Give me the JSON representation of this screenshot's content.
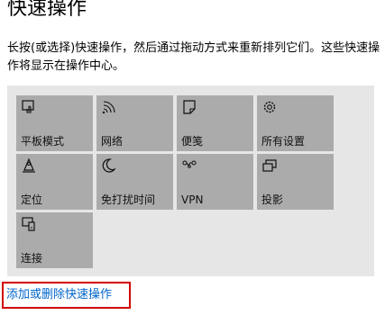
{
  "page": {
    "title": "快速操作",
    "description": "长按(或选择)快速操作，然后通过拖动方式来重新排列它们。这些快速操作将显示在操作中心。",
    "add_remove_link": "添加或删除快速操作"
  },
  "tiles": [
    {
      "label": "平板模式",
      "icon": "tablet-mode-icon"
    },
    {
      "label": "网络",
      "icon": "network-icon"
    },
    {
      "label": "便笺",
      "icon": "note-icon"
    },
    {
      "label": "所有设置",
      "icon": "gear-icon"
    },
    {
      "label": "定位",
      "icon": "location-icon"
    },
    {
      "label": "免打扰时间",
      "icon": "moon-icon"
    },
    {
      "label": "VPN",
      "icon": "vpn-icon"
    },
    {
      "label": "投影",
      "icon": "project-icon"
    },
    {
      "label": "连接",
      "icon": "connect-icon"
    }
  ],
  "colors": {
    "tile_bg": "#ababab",
    "panel_bg": "#e6e6e6",
    "link": "#0066cc",
    "highlight_border": "#d20000"
  }
}
